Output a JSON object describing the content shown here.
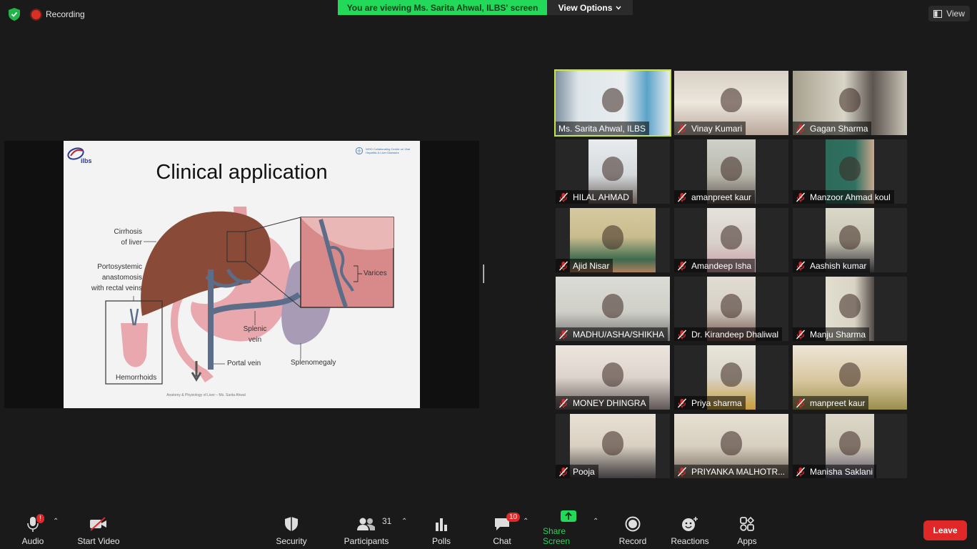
{
  "top_bar": {
    "recording_label": "Recording",
    "banner_text": "You are viewing Ms. Sarita Ahwal, ILBS' screen",
    "view_options_label": "View Options",
    "view_label": "View"
  },
  "slide": {
    "logo_text": "ilbs",
    "who_text": "WHO Collaborating Centre on Viral Hepatitis & Liver Diseases",
    "title": "Clinical application",
    "labels": {
      "cirrhosis_1": "Cirrhosis",
      "cirrhosis_2": "of liver",
      "porto_1": "Portosystemic",
      "porto_2": "anastomosis",
      "porto_3": "with rectal veins",
      "varices": "Varices",
      "splenic_1": "Splenic",
      "splenic_2": "vein",
      "portal_vein": "Portal vein",
      "splenomegaly": "Splenomegaly",
      "hemorrhoids": "Hemorrhoids"
    },
    "footer": "Anatomy & Physiology of Liver – Ms. Sarita Ahwal"
  },
  "participants": [
    {
      "name": "Ms. Sarita Ahwal, ILBS",
      "muted": false,
      "active": true
    },
    {
      "name": "Vinay Kumari",
      "muted": true
    },
    {
      "name": "Gagan Sharma",
      "muted": true
    },
    {
      "name": "HILAL AHMAD",
      "muted": true
    },
    {
      "name": "amanpreet kaur",
      "muted": true
    },
    {
      "name": "Manzoor Ahmad koul",
      "muted": true
    },
    {
      "name": "Ajid Nisar",
      "muted": true
    },
    {
      "name": "Amandeep Isha",
      "muted": true
    },
    {
      "name": "Aashish kumar",
      "muted": true
    },
    {
      "name": "MADHU/ASHA/SHIKHA",
      "muted": true
    },
    {
      "name": "Dr. Kirandeep Dhaliwal",
      "muted": true
    },
    {
      "name": "Manju Sharma",
      "muted": true
    },
    {
      "name": "MONEY DHINGRA",
      "muted": true
    },
    {
      "name": "Priya sharma",
      "muted": true
    },
    {
      "name": "manpreet kaur",
      "muted": true
    },
    {
      "name": "Pooja",
      "muted": true
    },
    {
      "name": "PRIYANKA MALHOTR...",
      "muted": true
    },
    {
      "name": "Manisha Saklani",
      "muted": true
    }
  ],
  "toolbar": {
    "audio_label": "Audio",
    "audio_alert": "!",
    "start_video_label": "Start Video",
    "security_label": "Security",
    "participants_label": "Participants",
    "participants_count": "31",
    "polls_label": "Polls",
    "chat_label": "Chat",
    "chat_badge": "10",
    "share_screen_label": "Share Screen",
    "record_label": "Record",
    "reactions_label": "Reactions",
    "apps_label": "Apps",
    "leave_label": "Leave"
  },
  "colors": {
    "banner_green": "#23d959",
    "share_green": "#23d959",
    "active_speaker_outline": "#c8e640",
    "leave_red": "#e02828",
    "muted_red": "#e02828"
  }
}
